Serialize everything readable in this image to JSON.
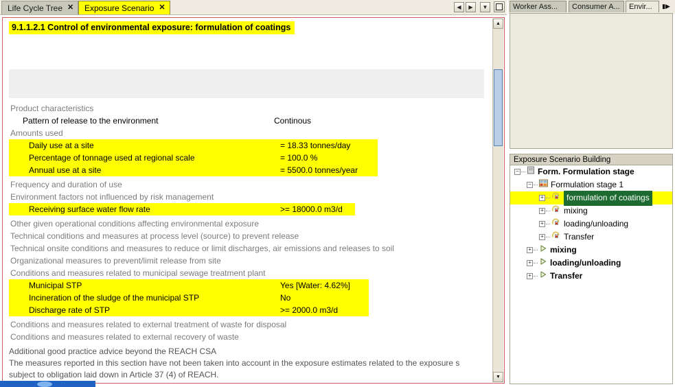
{
  "left_pane": {
    "tabs": [
      {
        "label": "Life Cycle Tree",
        "close": "✕",
        "active": false
      },
      {
        "label": "Exposure Scenario",
        "close": "✕",
        "active": true
      }
    ],
    "tab_nav": {
      "prev": "◀",
      "next": "▶",
      "menu": "▼",
      "maximize": ""
    },
    "document": {
      "title": "9.1.1.2.1 Control of environmental exposure: formulation of coatings",
      "rows": [
        {
          "type": "heading",
          "label": "Product characteristics",
          "value": ""
        },
        {
          "type": "item",
          "indent": true,
          "label": "Pattern of release to the environment",
          "value": "Continous",
          "highlight": false
        },
        {
          "type": "heading",
          "label": "Amounts used",
          "value": ""
        },
        {
          "type": "item",
          "indent": true,
          "label": "Daily use at a site",
          "value": "= 18.33 tonnes/day",
          "highlight": true
        },
        {
          "type": "item",
          "indent": true,
          "label": "Percentage of tonnage used at regional scale",
          "value": "= 100.0 %",
          "highlight": true
        },
        {
          "type": "item",
          "indent": true,
          "label": "Annual use at a site",
          "value": "= 5500.0 tonnes/year",
          "highlight": true
        },
        {
          "type": "heading",
          "label": "Frequency and duration of use",
          "value": ""
        },
        {
          "type": "heading",
          "label": "Environment factors not influenced by risk management",
          "value": ""
        },
        {
          "type": "item",
          "indent": true,
          "label": "Receiving surface water flow rate",
          "value": ">= 18000.0 m3/d",
          "highlight": true
        },
        {
          "type": "heading",
          "label": "Other given operational conditions affecting environmental exposure",
          "value": ""
        },
        {
          "type": "heading",
          "label": "Technical conditions and measures at process level (source) to prevent release",
          "value": ""
        },
        {
          "type": "heading",
          "label": "Technical onsite conditions and measures to reduce or limit discharges, air emissions and releases to soil",
          "value": ""
        },
        {
          "type": "heading",
          "label": "Organizational measures to prevent/limit release from site",
          "value": ""
        },
        {
          "type": "heading",
          "label": "Conditions and measures related to municipal sewage treatment plant",
          "value": ""
        },
        {
          "type": "item",
          "indent": true,
          "label": "Municipal STP",
          "value": "Yes [Water: 4.62%]",
          "highlight": true
        },
        {
          "type": "item",
          "indent": true,
          "label": "Incineration of the sludge of the municipal STP",
          "value": "No",
          "highlight": true
        },
        {
          "type": "item",
          "indent": true,
          "label": "Discharge rate of STP",
          "value": ">= 2000.0 m3/d",
          "highlight": true
        },
        {
          "type": "heading",
          "label": "Conditions and measures related to external treatment of waste for disposal",
          "value": ""
        },
        {
          "type": "heading",
          "label": "Conditions and measures related to external recovery of waste",
          "value": ""
        }
      ],
      "footer_paragraph": [
        "Additional good practice advice beyond the REACH CSA",
        "The measures reported in this section have not been taken into account in the exposure estimates related to the exposure s",
        "subject to obligation laid down in Article 37 (4) of REACH."
      ]
    },
    "scrollbar": {
      "up": "▲",
      "down": "▼"
    }
  },
  "right_pane": {
    "tabs": [
      {
        "label": "Worker Ass...",
        "active": false
      },
      {
        "label": "Consumer A...",
        "active": false
      },
      {
        "label": "Envir...",
        "active": true
      }
    ],
    "tab_overflow": "▮▶",
    "tree": {
      "header": "Exposure Scenario Building",
      "nodes": [
        {
          "depth": 0,
          "expander": "−",
          "icon": "document-icon",
          "label": "Form. Formulation stage",
          "bold": true,
          "selected": false,
          "row_highlight": false
        },
        {
          "depth": 1,
          "expander": "−",
          "icon": "stage-icon",
          "label": "Formulation stage  1",
          "bold": false,
          "selected": false,
          "row_highlight": false
        },
        {
          "depth": 2,
          "expander": "+",
          "icon": "contributing-icon",
          "label": "formulation of coatings",
          "bold": false,
          "selected": true,
          "row_highlight": true
        },
        {
          "depth": 2,
          "expander": "+",
          "icon": "contributing-icon",
          "label": "mixing",
          "bold": false,
          "selected": false,
          "row_highlight": false
        },
        {
          "depth": 2,
          "expander": "+",
          "icon": "contributing-icon",
          "label": "loading/unloading",
          "bold": false,
          "selected": false,
          "row_highlight": false
        },
        {
          "depth": 2,
          "expander": "+",
          "icon": "contributing-icon",
          "label": "Transfer",
          "bold": false,
          "selected": false,
          "row_highlight": false
        },
        {
          "depth": 1,
          "expander": "+",
          "icon": "arrow-icon",
          "label": "mixing",
          "bold": true,
          "selected": false,
          "row_highlight": false
        },
        {
          "depth": 1,
          "expander": "+",
          "icon": "arrow-icon",
          "label": "loading/unloading",
          "bold": true,
          "selected": false,
          "row_highlight": false
        },
        {
          "depth": 1,
          "expander": "+",
          "icon": "arrow-icon",
          "label": "Transfer",
          "bold": true,
          "selected": false,
          "row_highlight": false
        }
      ]
    }
  },
  "colors": {
    "highlight_yellow": "#ffff00",
    "selection_green": "#1e6b32",
    "frame_red": "#d06060",
    "panel_beige": "#eceadd",
    "taskbar_blue": "#1f62c4"
  }
}
